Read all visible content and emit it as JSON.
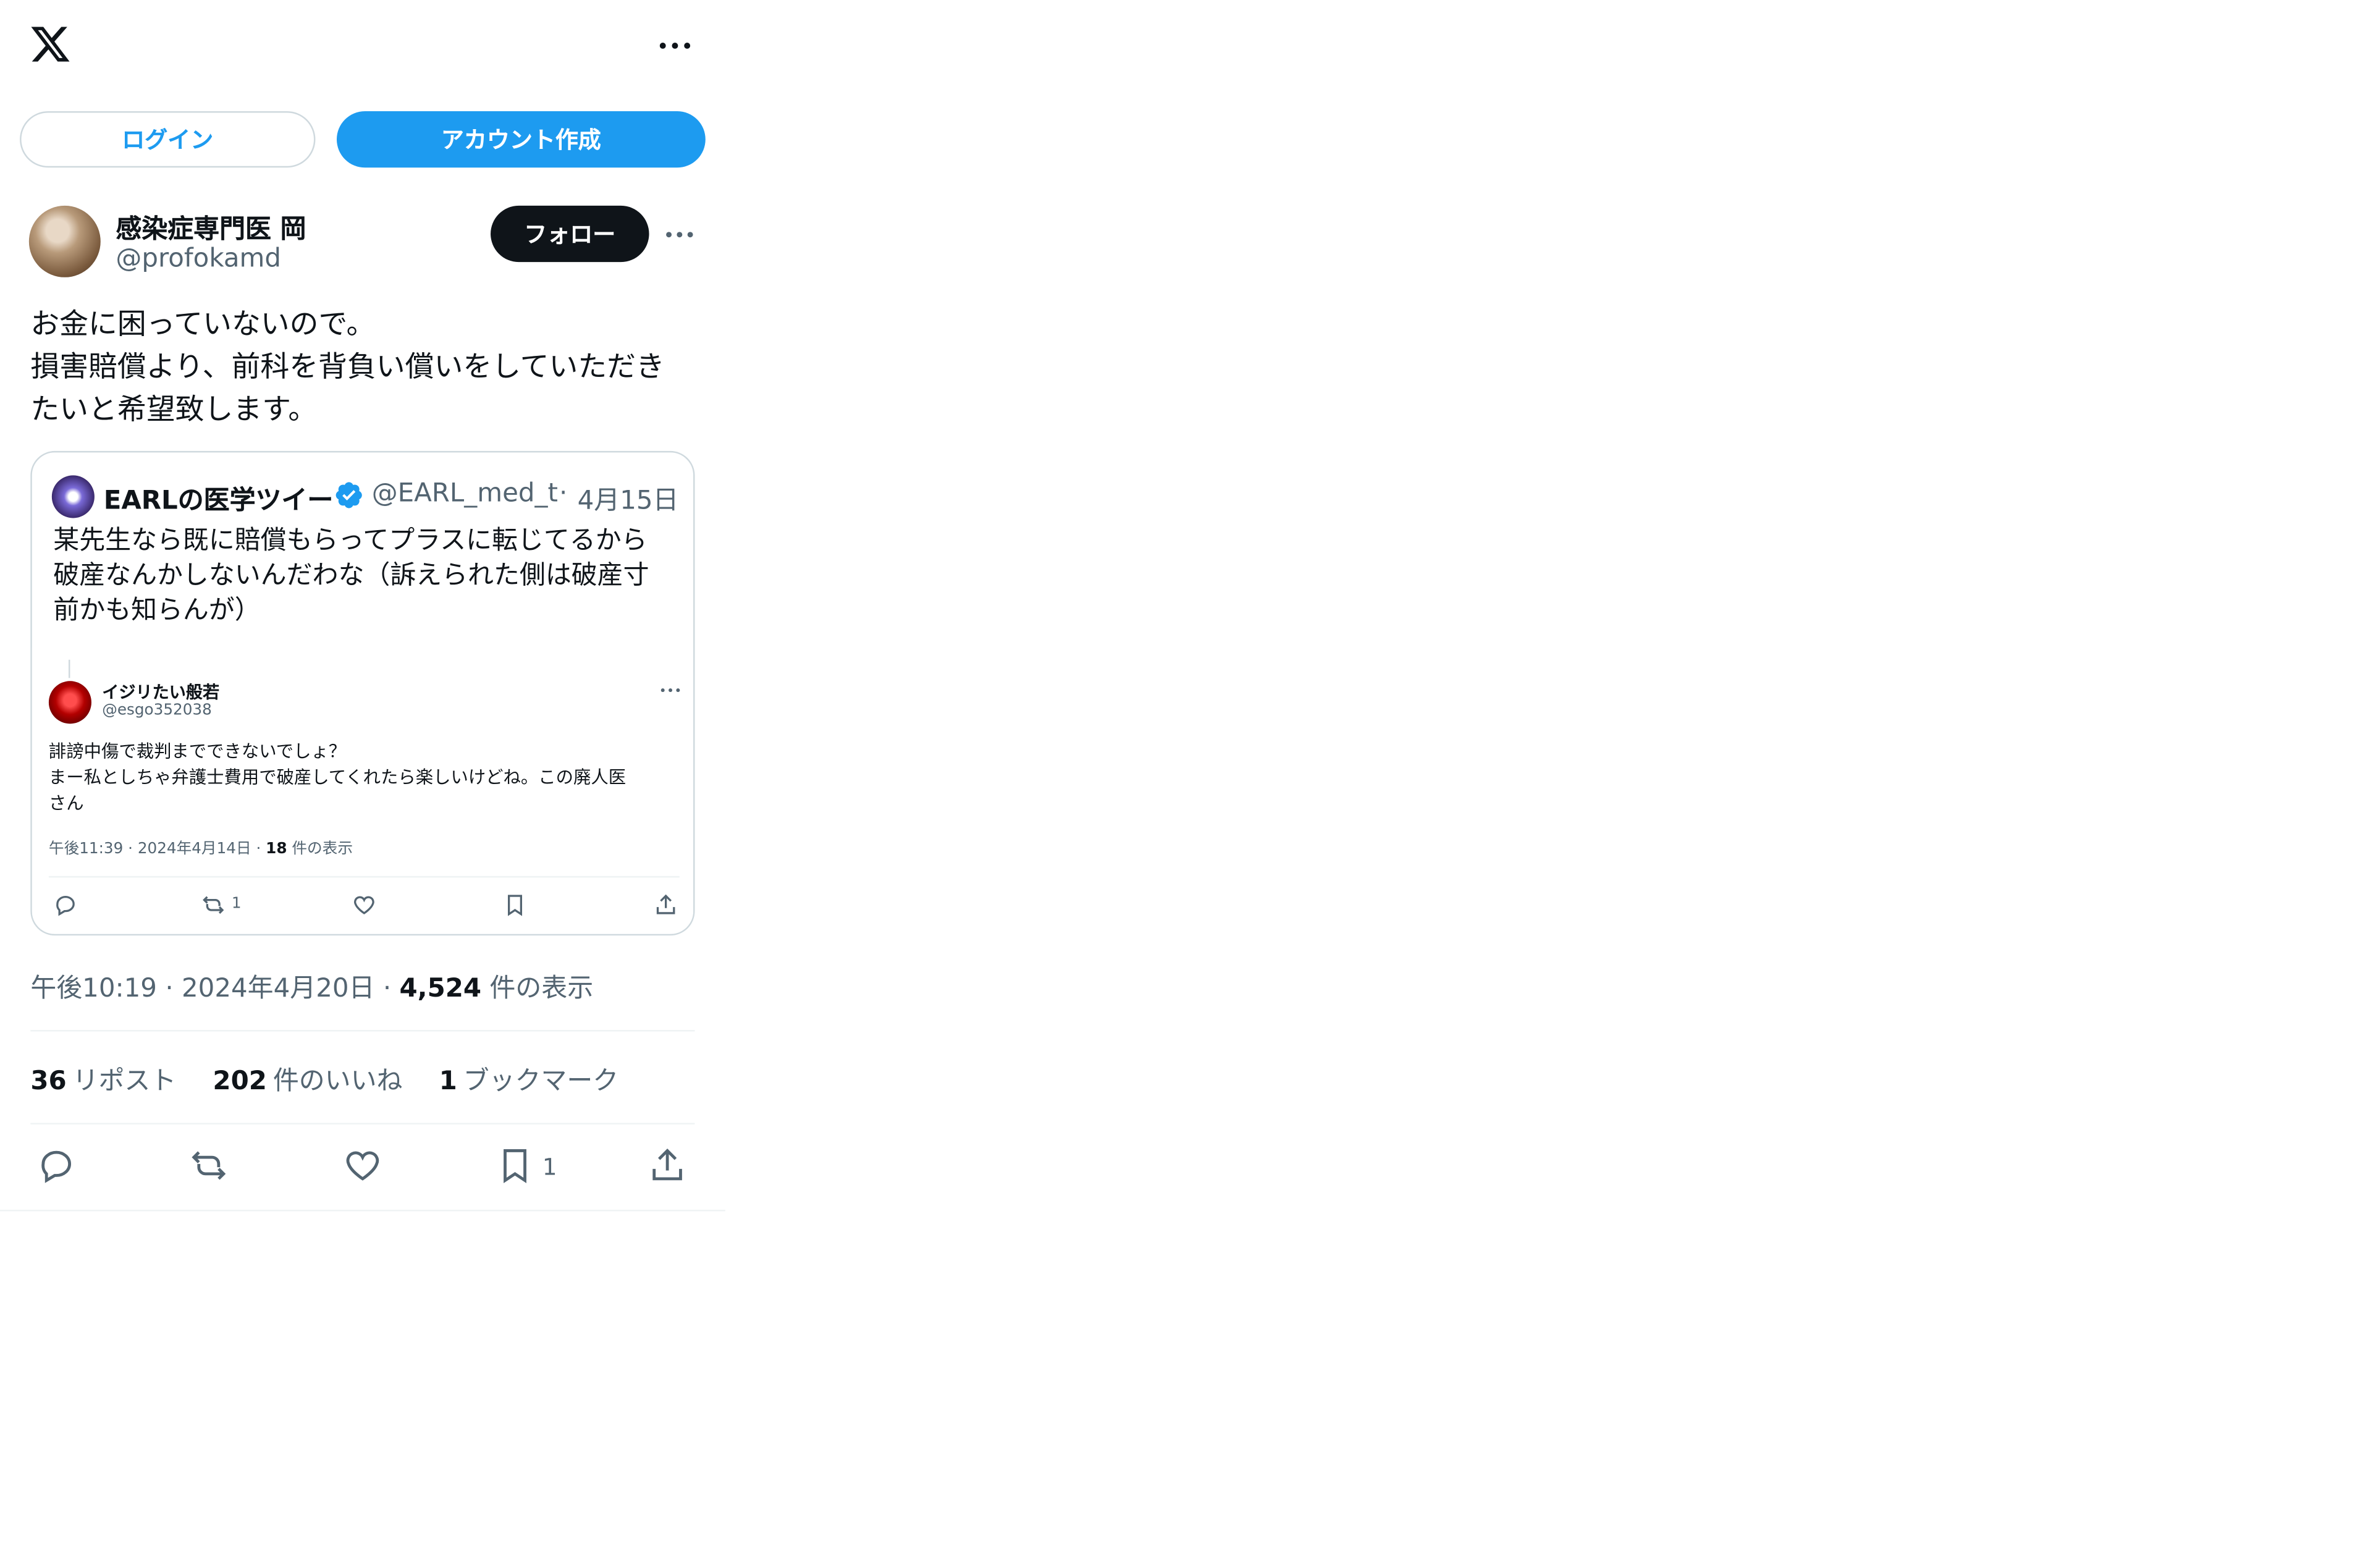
{
  "header": {
    "logo_icon": "x-logo-icon",
    "more_icon": "more-horizontal-icon"
  },
  "auth": {
    "login_label": "ログイン",
    "signup_label": "アカウント作成"
  },
  "author": {
    "name": "感染症専門医 岡",
    "handle": "@profokamd",
    "follow_label": "フォロー"
  },
  "tweet": {
    "text": "お金に困っていないので。\n損害賠償より、前科を背負い償いをしていただき\nたいと希望致します。",
    "time": "午後10:19",
    "date": "2024年4月20日",
    "views_count": "4,524",
    "views_label": "件の表示",
    "separator": "·"
  },
  "quote": {
    "name": "EARLの医学ツイー",
    "handle": "@EARL_med_t",
    "dot": "·",
    "date": "4月15日",
    "text": "某先生なら既に賠償もらってプラスに転じてるから\n破産なんかしないんだわな（訴えられた側は破産寸\n前かも知らんが）",
    "embedded": {
      "name": "イジリたい般若",
      "handle": "@esgo352038",
      "text": "誹謗中傷で裁判までできないでしょ？\nまー私としちゃ弁護士費用で破産してくれたら楽しいけどね。この廃人医\nさん",
      "meta_prefix": "午後11:39 · 2024年4月14日 · ",
      "meta_views": "18",
      "meta_suffix": " 件の表示",
      "retweet_count": "1"
    }
  },
  "stats": {
    "reposts_count": "36",
    "reposts_label": "リポスト",
    "likes_count": "202",
    "likes_label": "件のいいね",
    "bookmarks_count": "1",
    "bookmarks_label": "ブックマーク"
  },
  "actions": {
    "bookmark_count": "1"
  },
  "colors": {
    "accent": "#1d9bf0",
    "text": "#0f1419",
    "muted": "#536471",
    "border": "#cfd9de"
  }
}
